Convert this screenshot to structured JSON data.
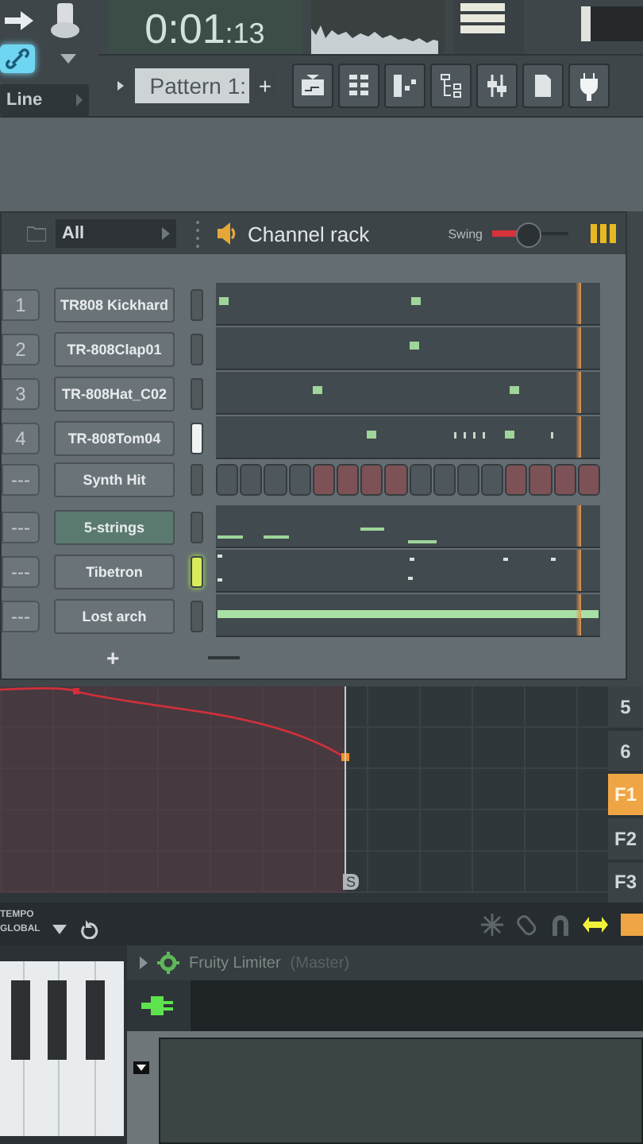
{
  "toolbar": {
    "snap": "Line",
    "time": "0:01",
    "time_sub": ":13",
    "pattern": "Pattern 1:",
    "pattern_add": "+"
  },
  "channel_rack": {
    "filter": "All",
    "title": "Channel rack",
    "swing_label": "Swing",
    "swing": {
      "level": 0.45
    },
    "add": "+",
    "channels": [
      {
        "number": "1",
        "name": "TR808 Kickhard",
        "selected": false,
        "lit": false,
        "kind": "steps"
      },
      {
        "number": "2",
        "name": "TR-808Clap01",
        "selected": false,
        "lit": false,
        "kind": "steps"
      },
      {
        "number": "3",
        "name": "TR-808Hat_C02",
        "selected": false,
        "lit": false,
        "kind": "steps"
      },
      {
        "number": "4",
        "name": "TR-808Tom04",
        "selected": false,
        "lit": true,
        "kind": "steps"
      },
      {
        "number": "---",
        "name": "Synth Hit",
        "selected": false,
        "lit": false,
        "kind": "buttons",
        "buttons": [
          {
            "on": false
          },
          {
            "on": false
          },
          {
            "on": false
          },
          {
            "on": false
          },
          {
            "on": true
          },
          {
            "on": true
          },
          {
            "on": true
          },
          {
            "on": true
          },
          {
            "on": false
          },
          {
            "on": false
          },
          {
            "on": false
          },
          {
            "on": false
          },
          {
            "on": true
          },
          {
            "on": true
          },
          {
            "on": true
          },
          {
            "on": true
          }
        ]
      },
      {
        "number": "---",
        "name": "5-strings",
        "selected": true,
        "lit": false,
        "kind": "notes"
      },
      {
        "number": "---",
        "name": "Tibetron",
        "selected": false,
        "lit": true,
        "kind": "notes"
      },
      {
        "number": "---",
        "name": "Lost arch",
        "selected": false,
        "lit": false,
        "kind": "notes"
      }
    ]
  },
  "playlist": {
    "marker": "S",
    "tracks": [
      {
        "label": "5",
        "selected": false
      },
      {
        "label": "6",
        "selected": false
      },
      {
        "label": "F1",
        "selected": true
      },
      {
        "label": "F2",
        "selected": false
      },
      {
        "label": "F3",
        "selected": false
      }
    ],
    "tempo_label": "TEMPO",
    "global_label": "GLOBAL"
  },
  "mixer": {
    "plugin": "Fruity Limiter",
    "target": "(Master)"
  }
}
